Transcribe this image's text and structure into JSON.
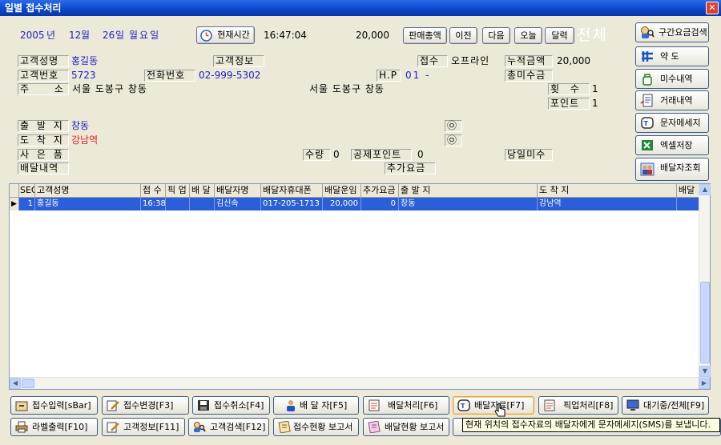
{
  "window": {
    "title": "일별 접수처리",
    "close_icon": "✕"
  },
  "datebar": {
    "year": "2005",
    "year_unit": "년",
    "month": "12",
    "month_unit": "월",
    "day": "26",
    "day_unit": "일",
    "weekday": "월요일",
    "now_button": "현재시간",
    "time": "16:47:04",
    "total": "20,000",
    "buttons": {
      "sales_total": "판매총액",
      "prev": "이전",
      "next": "다음",
      "today": "오늘",
      "calendar": "달력"
    },
    "scope": "전체"
  },
  "customer": {
    "name_label": "고객성명",
    "name": "홍길동",
    "info_label": "고객정보",
    "receipt_label": "접수",
    "receipt_value": "오프라인",
    "cumulative_label": "누적금액",
    "cumulative_value": "20,000",
    "number_label": "고객번호",
    "number": "5723",
    "phone_label": "전화번호",
    "phone": "02-999-5302",
    "hp_label": "H.P",
    "hp": "01 -",
    "unpaid_label": "총미수금",
    "address_label": "주 소",
    "address": "서울 도봉구 창동",
    "address2": "서울 도봉구 창동",
    "count_label": "횟 수",
    "count": "1",
    "point_label": "포인트",
    "point": "1"
  },
  "delivery": {
    "origin_label": "출 발 지",
    "origin": "창동",
    "origin_icon": "㉧",
    "dest_label": "도 착 지",
    "dest": "강남역",
    "dest_icon": "㉧",
    "goods_label": "사 은 품",
    "qty_label": "수량",
    "qty": "0",
    "deduct_label": "공제포인트",
    "deduct": "0",
    "day_unpaid_label": "당일미수",
    "history_label": "배달내역",
    "extra_label": "추가요금"
  },
  "sidebar": [
    {
      "label": "구간요금검색",
      "icon": "search-person-icon"
    },
    {
      "label": "약 도",
      "icon": "map-icon"
    },
    {
      "label": "미수내역",
      "icon": "bag-icon"
    },
    {
      "label": "거래내역",
      "icon": "document-icon"
    },
    {
      "label": "문자메세지",
      "icon": "phone-icon"
    },
    {
      "label": "엑셀저장",
      "icon": "excel-icon"
    },
    {
      "label": "배달자조회",
      "icon": "people-icon"
    }
  ],
  "grid": {
    "columns": [
      "SEQ",
      "고객성명",
      "접 수",
      "픽 업",
      "배 달",
      "배달자명",
      "배달자휴대폰",
      "배달운임",
      "추가요금",
      "출 발 지",
      "도 착 지",
      "배달"
    ],
    "rows": [
      [
        "1",
        "홍길동",
        "16:38",
        "",
        "",
        "김신속",
        "017-205-1713",
        "20,000",
        "0",
        "창동",
        "강남역",
        ""
      ]
    ]
  },
  "footer": {
    "row1": [
      {
        "label": "접수입력[sBar]",
        "icon": "drawer-icon"
      },
      {
        "label": "접수변경[F3]",
        "icon": "edit-icon"
      },
      {
        "label": "접수취소[F4]",
        "icon": "save-icon"
      },
      {
        "label": "배 달 자[F5]",
        "icon": "person-icon"
      },
      {
        "label": "배달처리[F6]",
        "icon": "list-icon"
      },
      {
        "label": "배달자료[F7]",
        "icon": "phone-icon"
      },
      {
        "label": "픽업처리[F8]",
        "icon": "list-icon"
      },
      {
        "label": "대기중/전체[F9]",
        "icon": "monitor-icon"
      }
    ],
    "row2": [
      {
        "label": "라벨출력[F10]",
        "icon": "printer-icon"
      },
      {
        "label": "고객정보[F11]",
        "icon": "edit-icon"
      },
      {
        "label": "고객검색[F12]",
        "icon": "search-person-icon"
      },
      {
        "label": "접수현황 보고서",
        "icon": "report-icon"
      },
      {
        "label": "배달현황 보고서",
        "icon": "report-icon"
      }
    ]
  },
  "tooltip": "현재 위치의 접수자료의 배달자에게 문자메세지(SMS)를 보냅니다.",
  "colors": {
    "titlebar": "#0a46c8",
    "selection": "#2b5fd9",
    "blue_text": "#2020c8",
    "red_text": "#e02020"
  }
}
